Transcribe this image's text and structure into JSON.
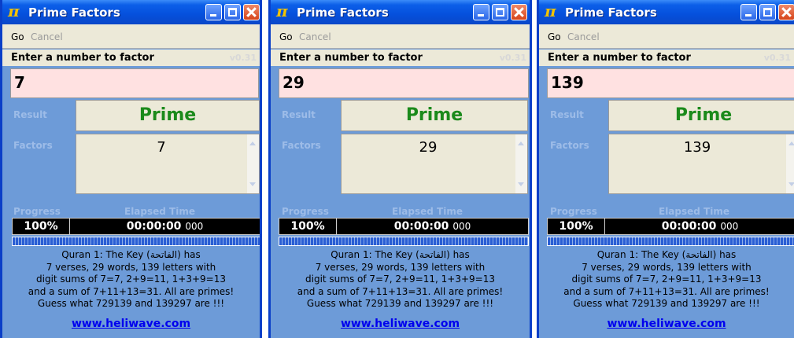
{
  "app": {
    "title": "Prime Factors",
    "version": "v0.31",
    "menu_go": "Go",
    "menu_cancel": "Cancel",
    "prompt": "Enter a number to factor",
    "result_label": "Result",
    "factors_label": "Factors",
    "progress_label": "Progress",
    "elapsed_label": "Elapsed Time",
    "info_lines": [
      "Quran 1: The Key (الفاتحة) has",
      "7 verses, 29 words, 139 letters with",
      "digit sums of 7=7, 2+9=11, 1+3+9=13",
      "and a sum of 7+11+13=31. All are primes!",
      "Guess what 729139 and 139297 are !!!"
    ],
    "link": "www.heliwave.com",
    "colors": {
      "titlebar": "#0550dc",
      "body": "#6d9bd8",
      "input_bg": "#ffe1e1",
      "prime_text": "#1b8a1b"
    }
  },
  "windows": [
    {
      "input": "7",
      "result": "Prime",
      "factors": "7",
      "progress": "100%",
      "progress_value": 1.0,
      "elapsed": "00:00:00",
      "elapsed_ms": "000"
    },
    {
      "input": "29",
      "result": "Prime",
      "factors": "29",
      "progress": "100%",
      "progress_value": 1.0,
      "elapsed": "00:00:00",
      "elapsed_ms": "000"
    },
    {
      "input": "139",
      "result": "Prime",
      "factors": "139",
      "progress": "100%",
      "progress_value": 1.0,
      "elapsed": "00:00:00",
      "elapsed_ms": "000"
    }
  ]
}
